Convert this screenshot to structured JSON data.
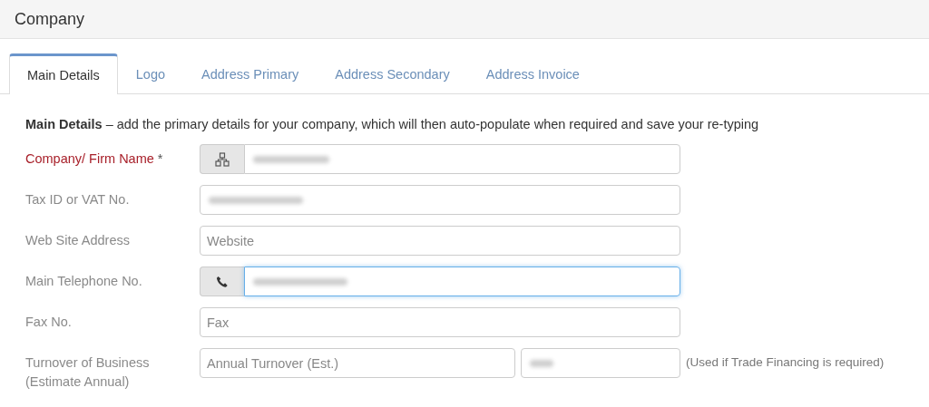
{
  "header": {
    "title": "Company"
  },
  "tabs": [
    {
      "label": "Main Details",
      "selected": true
    },
    {
      "label": "Logo",
      "selected": false
    },
    {
      "label": "Address Primary",
      "selected": false
    },
    {
      "label": "Address Secondary",
      "selected": false
    },
    {
      "label": "Address Invoice",
      "selected": false
    }
  ],
  "intro": "**Main Details** – add the primary details for your company, which will then auto-populate when required and save your re-typing",
  "fields": [
    {
      "label": "Company/ Firm Name",
      "required": true,
      "required_mark": "*",
      "kind": "org",
      "inputs": [
        {
          "redacted": true,
          "focused": false
        }
      ]
    },
    {
      "label": "Tax ID or VAT No.",
      "required": false,
      "inputs": [
        {
          "redacted": true,
          "focused": false
        }
      ]
    },
    {
      "label": "Web Site Address",
      "required": false,
      "inputs": [
        {
          "placeholder": "Website",
          "focused": false
        }
      ]
    },
    {
      "label": "Main Telephone No.",
      "required": false,
      "kind": "phone",
      "inputs": [
        {
          "redacted": true,
          "focused": true
        }
      ]
    },
    {
      "label": "Fax No.",
      "required": false,
      "inputs": [
        {
          "placeholder": "Fax",
          "focused": false
        }
      ]
    },
    {
      "label": "Turnover of Business (Estimate Annual)",
      "required": false,
      "inputs": [
        {
          "placeholder": "Annual Turnover (Est.)",
          "focused": false
        },
        {
          "redacted": true,
          "focused": false
        }
      ],
      "note": "(Used if Trade Financing is required)"
    }
  ]
}
